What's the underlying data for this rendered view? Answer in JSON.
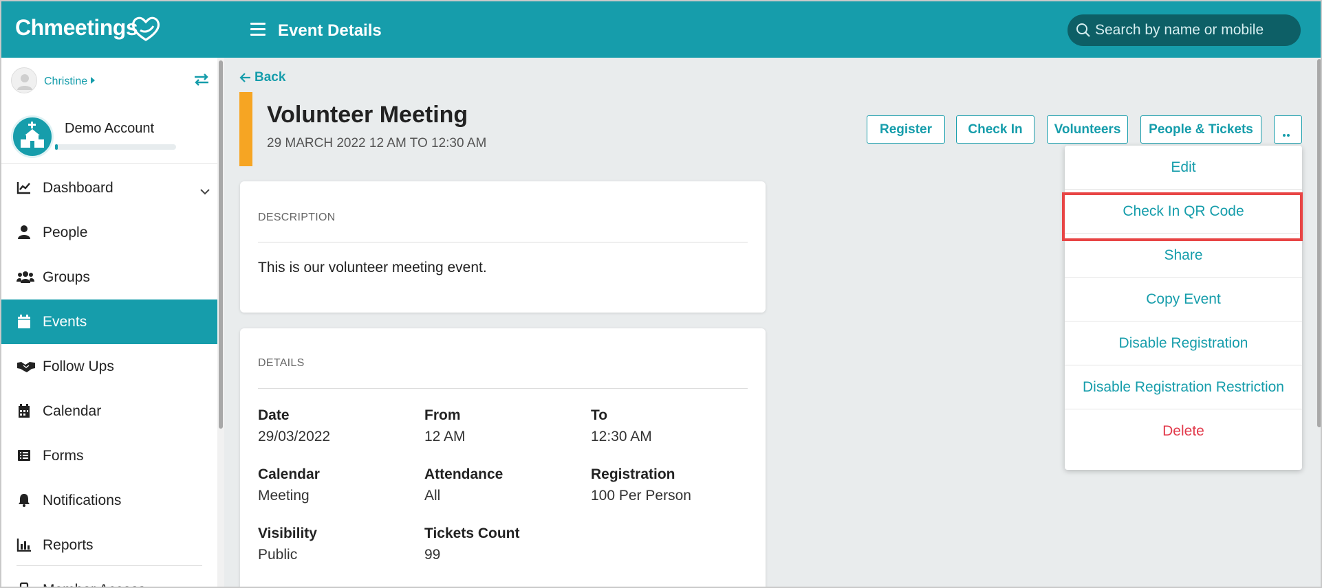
{
  "app": {
    "logo_text": "Chmeetings",
    "page_title": "Event Details"
  },
  "search": {
    "placeholder": "Search by name or mobile"
  },
  "user": {
    "name": "Christine"
  },
  "account": {
    "name": "Demo Account",
    "progress": 0.02
  },
  "nav": {
    "items": [
      {
        "label": "Dashboard",
        "icon": "chart-line-icon"
      },
      {
        "label": "People",
        "icon": "person-icon"
      },
      {
        "label": "Groups",
        "icon": "users-icon"
      },
      {
        "label": "Events",
        "icon": "calendar-icon",
        "active": true
      },
      {
        "label": "Follow Ups",
        "icon": "handshake-icon"
      },
      {
        "label": "Calendar",
        "icon": "calendar-grid-icon"
      },
      {
        "label": "Forms",
        "icon": "list-icon"
      },
      {
        "label": "Notifications",
        "icon": "bell-icon"
      },
      {
        "label": "Reports",
        "icon": "bar-chart-icon"
      },
      {
        "label": "Member Access",
        "icon": "mobile-icon"
      }
    ]
  },
  "event": {
    "back_label": "Back",
    "title": "Volunteer Meeting",
    "date_range": "29 MARCH 2022 12 AM TO 12:30 AM",
    "accent_color": "#f6a523"
  },
  "actions": {
    "register": "Register",
    "check_in": "Check In",
    "volunteers": "Volunteers",
    "people_tickets": "People & Tickets"
  },
  "description": {
    "heading": "DESCRIPTION",
    "text": "This is our volunteer meeting event."
  },
  "details": {
    "heading": "DETAILS",
    "date_label": "Date",
    "date_value": "29/03/2022",
    "from_label": "From",
    "from_value": "12 AM",
    "to_label": "To",
    "to_value": "12:30 AM",
    "calendar_label": "Calendar",
    "calendar_value": "Meeting",
    "attendance_label": "Attendance",
    "attendance_value": "All",
    "registration_label": "Registration",
    "registration_value": "100 Per Person",
    "visibility_label": "Visibility",
    "visibility_value": "Public",
    "tickets_label": "Tickets Count",
    "tickets_value": "99"
  },
  "menu": {
    "items": [
      {
        "label": "Edit"
      },
      {
        "label": "Check In QR Code",
        "highlighted": true
      },
      {
        "label": "Share"
      },
      {
        "label": "Copy Event"
      },
      {
        "label": "Disable Registration"
      },
      {
        "label": "Disable Registration Restriction"
      },
      {
        "label": "Delete",
        "danger": true
      }
    ]
  },
  "colors": {
    "brand": "#169dab",
    "danger": "#e23a4b",
    "highlight": "#e84545"
  }
}
